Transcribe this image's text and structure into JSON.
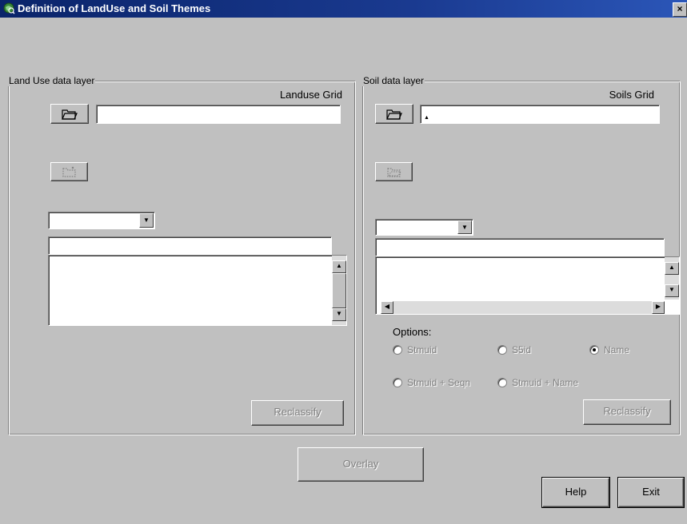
{
  "window": {
    "title": "Definition of LandUse and Soil Themes",
    "close_glyph": "×"
  },
  "landuse": {
    "group_label": "Land Use data layer",
    "grid_label": "Landuse Grid",
    "grid_path": "",
    "dropdown_value": "",
    "field_value": "",
    "list_items": [],
    "reclassify_label": "Reclassify"
  },
  "soil": {
    "group_label": "Soil data layer",
    "grid_label": "Soils Grid",
    "grid_path": "",
    "dropdown_value": "",
    "field_value": "",
    "list_items": [],
    "options_label": "Options:",
    "options": [
      {
        "label": "Stmuid",
        "selected": false
      },
      {
        "label": "S5id",
        "selected": false
      },
      {
        "label": "Name",
        "selected": true
      },
      {
        "label": "Stmuid + Seqn",
        "selected": false
      },
      {
        "label": "Stmuid + Name",
        "selected": false
      }
    ],
    "reclassify_label": "Reclassify"
  },
  "footer": {
    "overlay_label": "Overlay",
    "help_label": "Help",
    "exit_label": "Exit"
  },
  "icons": {
    "folder_open": "folder-open-icon",
    "folder_dotted": "folder-dotted-icon",
    "dropdown_arrow": "chevron-down-icon"
  }
}
